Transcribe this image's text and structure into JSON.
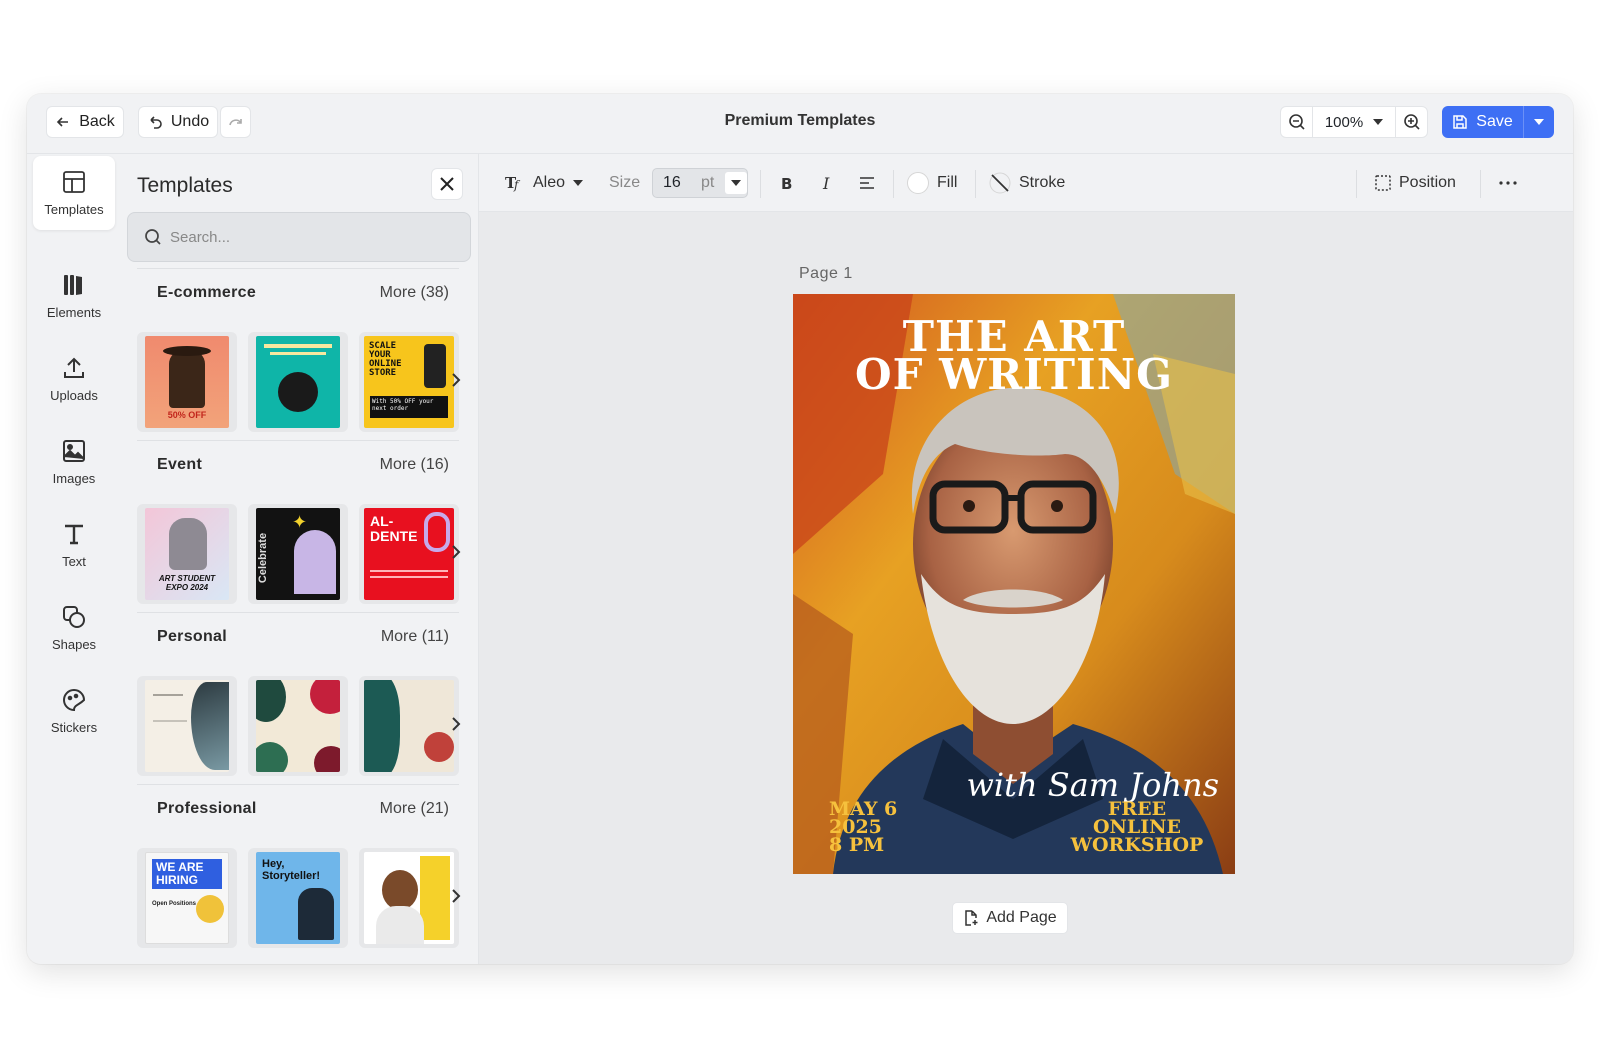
{
  "app": {
    "title": "Premium Templates"
  },
  "topbar": {
    "back_label": "Back",
    "undo_label": "Undo",
    "zoom": "100%",
    "save_label": "Save"
  },
  "rail": {
    "items": [
      {
        "label": "Templates",
        "icon": "layout-icon",
        "active": true
      },
      {
        "label": "Elements",
        "icon": "elements-icon"
      },
      {
        "label": "Uploads",
        "icon": "upload-icon"
      },
      {
        "label": "Images",
        "icon": "image-icon"
      },
      {
        "label": "Text",
        "icon": "text-icon"
      },
      {
        "label": "Shapes",
        "icon": "shapes-icon"
      },
      {
        "label": "Stickers",
        "icon": "sticker-icon"
      }
    ]
  },
  "panel": {
    "title": "Templates",
    "search_placeholder": "Search...",
    "categories": [
      {
        "name": "E-commerce",
        "more": "More (38)"
      },
      {
        "name": "Event",
        "more": "More (16)"
      },
      {
        "name": "Personal",
        "more": "More (11)"
      },
      {
        "name": "Professional",
        "more": "More (21)"
      }
    ],
    "thumb_texts": {
      "ecom3": "SCALE YOUR ONLINE STORE",
      "ecom3_sub": "With 50% OFF your next order",
      "ecom1": "50% OFF",
      "event1": "ART STUDENT EXPO 2024",
      "event2": "Celebrate",
      "event3": "AL-DENTE",
      "prof1": "WE ARE HIRING",
      "prof1_sub": "Open Positions",
      "prof2": "Hey, Storyteller!"
    }
  },
  "toolbar": {
    "font": "Aleo",
    "size_label": "Size",
    "size_value": "16",
    "size_unit": "pt",
    "fill_label": "Fill",
    "stroke_label": "Stroke",
    "position_label": "Position"
  },
  "canvas": {
    "page_label": "Page  1",
    "add_page_label": "Add Page",
    "poster": {
      "title_line1": "THE ART",
      "title_line2": "OF WRITING",
      "date_line1": "MAY 6",
      "date_line2": "2025",
      "date_line3": "8 PM",
      "host": "with Sam Johns",
      "event_line1": "FREE",
      "event_line2": "ONLINE",
      "event_line3": "WORKSHOP"
    }
  },
  "colors": {
    "accent": "#3e6ff4",
    "poster_text": "#ffffff",
    "poster_yellow": "#f6c13d"
  }
}
